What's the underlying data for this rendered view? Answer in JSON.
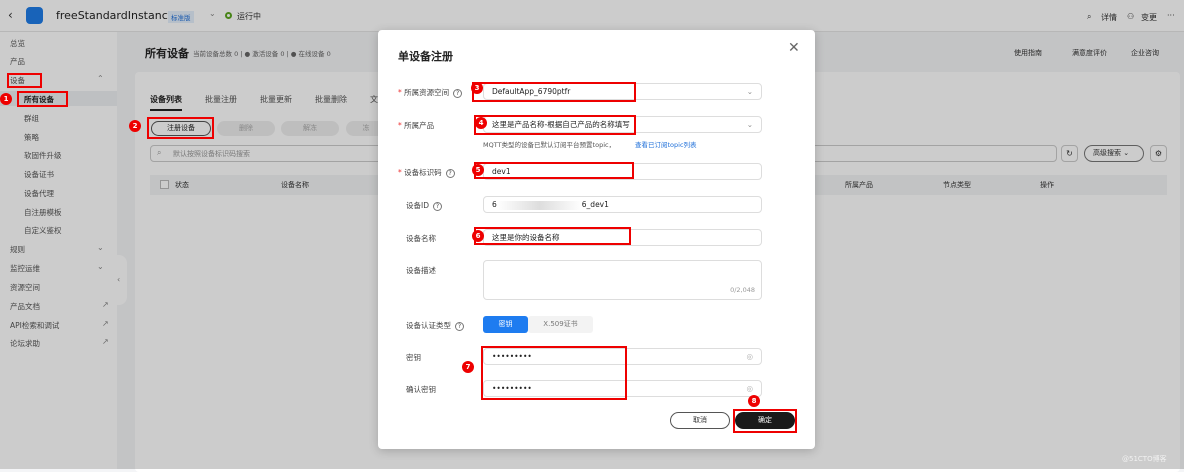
{
  "topbar": {
    "instance": "freeStandardInstance",
    "edition": "标准版",
    "status": "运行中",
    "details": "详情",
    "change": "变更",
    "more": "···"
  },
  "sidebar": {
    "items": [
      {
        "label": "总览"
      },
      {
        "label": "产品"
      },
      {
        "label": "设备"
      },
      {
        "label": "所有设备"
      },
      {
        "label": "群组"
      },
      {
        "label": "策略"
      },
      {
        "label": "软固件升级"
      },
      {
        "label": "设备证书"
      },
      {
        "label": "设备代理"
      },
      {
        "label": "自注册模板"
      },
      {
        "label": "自定义鉴权"
      },
      {
        "label": "规则"
      },
      {
        "label": "监控运维"
      },
      {
        "label": "资源空间"
      },
      {
        "label": "产品文档"
      },
      {
        "label": "API检索和调试"
      },
      {
        "label": "论坛求助"
      }
    ]
  },
  "main": {
    "title": "所有设备",
    "stats": "当前设备总数 0 | ● 激活设备 0 | ● 在线设备 0",
    "links": [
      "使用指南",
      "满意度评价",
      "企业咨询"
    ],
    "tabs": [
      "设备列表",
      "批量注册",
      "批量更新",
      "批量删除",
      "文"
    ],
    "buttons": [
      "注册设备",
      "删除",
      "解冻",
      "冻"
    ],
    "search_placeholder": "默认按照设备标识码搜索",
    "advanced": "高级搜索",
    "columns": [
      "状态",
      "设备名称",
      "所属产品",
      "节点类型",
      "操作"
    ]
  },
  "modal": {
    "title": "单设备注册",
    "space_label": "所属资源空间",
    "space_value": "DefaultApp_6790ptfr",
    "product_label": "所属产品",
    "product_value": "这里是产品名称-根据自己产品的名称填写",
    "hint": "MQTT类型的设备已默认订阅平台预置topic，",
    "hint_link": "查看已订阅topic列表",
    "node_label": "设备标识码",
    "node_value": "dev1",
    "id_label": "设备ID",
    "id_prefix": "6",
    "id_suffix": "6_dev1",
    "name_label": "设备名称",
    "name_value": "这里是你的设备名称",
    "desc_label": "设备描述",
    "desc_count": "0/2,048",
    "auth_label": "设备认证类型",
    "auth_options": [
      "密钥",
      "X.509证书"
    ],
    "secret_label": "密钥",
    "secret_value": "•••••••••",
    "confirm_label": "确认密钥",
    "confirm_value": "•••••••••",
    "cancel": "取消",
    "ok": "确定"
  },
  "annotations": [
    "1",
    "2",
    "3",
    "4",
    "5",
    "6",
    "7",
    "8"
  ],
  "watermark": "@51CTO博客"
}
